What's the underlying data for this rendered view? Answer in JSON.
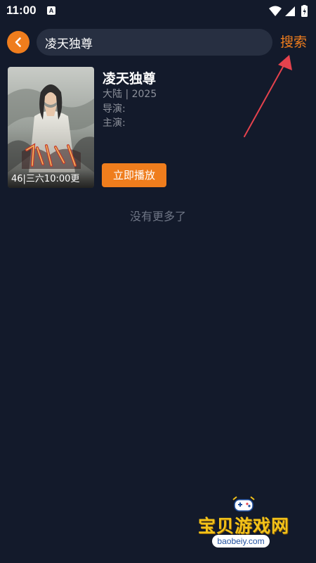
{
  "status_bar": {
    "time": "11:00",
    "app_icon_letter": "A"
  },
  "header": {
    "search_value": "凌天独尊",
    "search_button_label": "搜索"
  },
  "results": [
    {
      "title": "凌天独尊",
      "region_year": "大陆 | 2025",
      "director_label": "导演:",
      "cast_label": "主演:",
      "poster_caption": "46|三六10:00更",
      "play_label": "立即播放"
    }
  ],
  "footer_message": "没有更多了",
  "watermark": {
    "brand": "宝贝游戏网",
    "url": "baobeiy.com"
  },
  "colors": {
    "background": "#131a2b",
    "accent": "#ef7d1d",
    "search_bg": "#272f41",
    "annotation": "#e5424d"
  }
}
